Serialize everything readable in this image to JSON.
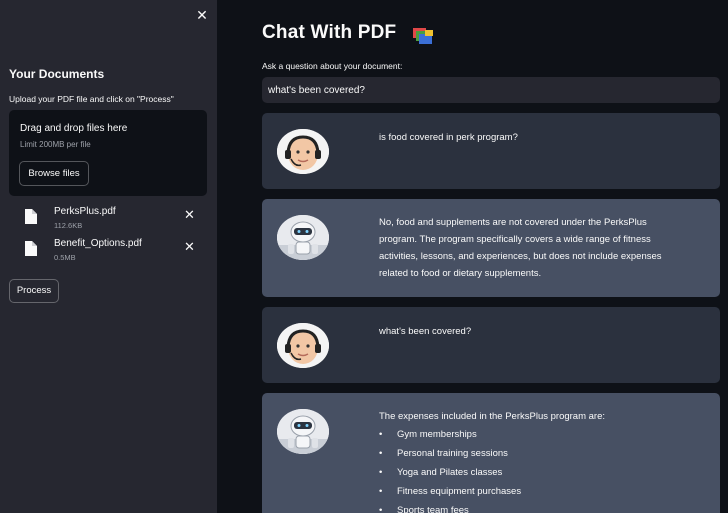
{
  "sidebar": {
    "close_label": "✕",
    "title": "Your Documents",
    "subtitle": "Upload your PDF file and click on \"Process\"",
    "uploader": {
      "drag_text": "Drag and drop files here",
      "limit_text": "Limit 200MB per file",
      "browse_label": "Browse files"
    },
    "files": [
      {
        "name": "PerksPlus.pdf",
        "size": "112.6KB"
      },
      {
        "name": "Benefit_Options.pdf",
        "size": "0.5MB"
      }
    ],
    "remove_label": "✕",
    "process_label": "Process"
  },
  "main": {
    "title": "Chat With PDF",
    "title_icon": "books-icon",
    "question_label": "Ask a question about your document:",
    "question_value": "what's been covered?",
    "messages": [
      {
        "role": "user",
        "text": "is food covered in perk program?"
      },
      {
        "role": "bot",
        "text": "No, food and supplements are not covered under the PerksPlus program. The program specifically covers a wide range of fitness activities, lessons, and experiences, but does not include expenses related to food or dietary supplements."
      },
      {
        "role": "user",
        "text": "what's been covered?"
      },
      {
        "role": "bot",
        "intro": "The expenses included in the PerksPlus program are:",
        "items": [
          "Gym memberships",
          "Personal training sessions",
          "Yoga and Pilates classes",
          "Fitness equipment purchases",
          "Sports team fees"
        ]
      }
    ]
  },
  "colors": {
    "main_bg": "#0e1117",
    "sidebar_bg": "#262730",
    "user_msg_bg": "#2b313e",
    "bot_msg_bg": "#475063"
  }
}
